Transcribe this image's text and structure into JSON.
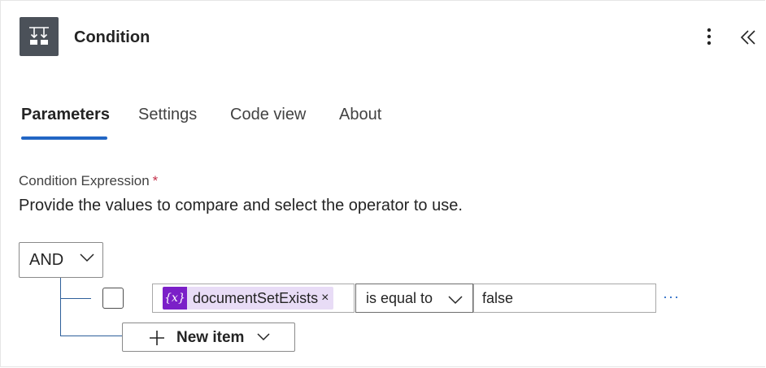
{
  "header": {
    "title": "Condition",
    "icon": "condition-split-icon",
    "more_icon": "more-vertical-icon",
    "collapse_icon": "double-chevron-left-icon"
  },
  "tabs": [
    {
      "label": "Parameters",
      "active": true
    },
    {
      "label": "Settings",
      "active": false
    },
    {
      "label": "Code view",
      "active": false
    },
    {
      "label": "About",
      "active": false
    }
  ],
  "condition": {
    "label": "Condition Expression",
    "required_mark": "*",
    "description": "Provide the values to compare and select the operator to use.",
    "group_operator": "AND",
    "rows": [
      {
        "left_token": {
          "icon_text": "{x}",
          "text": "documentSetExists",
          "remove": "×"
        },
        "operator": "is equal to",
        "right_value": "false",
        "more": "···"
      }
    ],
    "new_item_label": "New item"
  },
  "colors": {
    "accent": "#2266c4",
    "token_bg": "#e8dcf6",
    "token_icon_bg": "#7b1fc8",
    "header_icon_bg": "#4b5159",
    "required": "#c4314b"
  }
}
